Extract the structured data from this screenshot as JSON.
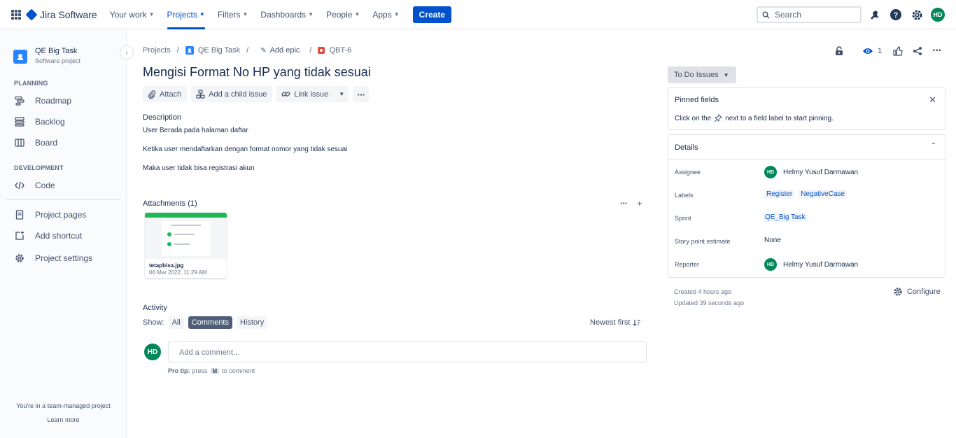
{
  "topnav": {
    "product": "Jira Software",
    "items": [
      {
        "label": "Your work",
        "active": false
      },
      {
        "label": "Projects",
        "active": true
      },
      {
        "label": "Filters",
        "active": false
      },
      {
        "label": "Dashboards",
        "active": false
      },
      {
        "label": "People",
        "active": false
      },
      {
        "label": "Apps",
        "active": false
      }
    ],
    "create_label": "Create",
    "search_placeholder": "Search",
    "avatar_initials": "HD",
    "accent_color": "#0052cc"
  },
  "sidebar": {
    "project_name": "QE Big Task",
    "project_type": "Software project",
    "section_planning": "PLANNING",
    "section_development": "DEVELOPMENT",
    "items": {
      "roadmap": "Roadmap",
      "backlog": "Backlog",
      "board": "Board",
      "code": "Code",
      "project_pages": "Project pages",
      "add_shortcut": "Add shortcut",
      "project_settings": "Project settings"
    },
    "footer_text": "You're in a team-managed project",
    "footer_link": "Learn more"
  },
  "breadcrumb": {
    "projects": "Projects",
    "project": "QE Big Task",
    "add_epic": "Add epic",
    "issue_key": "QBT-6"
  },
  "issue": {
    "title": "Mengisi Format No HP yang tidak sesuai",
    "actions": {
      "attach": "Attach",
      "add_child": "Add a child issue",
      "link_issue": "Link issue"
    },
    "description_label": "Description",
    "description_lines": [
      "User Berada pada halaman daftar",
      "Ketika user mendaftarkan dengan format nomor yang tidak sesuai",
      "Maka user tidak bisa registrasi akun"
    ],
    "attachments_label": "Attachments (1)",
    "attachment": {
      "file_name": "tetapbisa.jpg",
      "date": "06 Mar 2022, 11:29 AM"
    },
    "activity_label": "Activity",
    "show_label": "Show:",
    "filters": {
      "all": "All",
      "comments": "Comments",
      "history": "History"
    },
    "sort_label": "Newest first",
    "comment_avatar": "HD",
    "comment_placeholder": "Add a comment...",
    "protip_label": "Pro tip:",
    "protip_press": "press",
    "protip_key": "M",
    "protip_rest": "to comment"
  },
  "right": {
    "watchers_count": "1",
    "status_label": "To Do Issues",
    "pinned_title": "Pinned fields",
    "pinned_hint_before": "Click on the",
    "pinned_hint_after": "next to a field label to start pinning.",
    "details_title": "Details",
    "fields": {
      "assignee_label": "Assignee",
      "assignee": "Helmy Yusuf Darmawan",
      "labels_label": "Labels",
      "labels": [
        "Register",
        "NegativeCase"
      ],
      "sprint_label": "Sprint",
      "sprint": "QE_Big Task",
      "story_points_label": "Story point estimate",
      "story_points": "None",
      "reporter_label": "Reporter",
      "reporter": "Helmy Yusuf Darmawan",
      "avatar_initials": "HD"
    },
    "created": "Created 4 hours ago",
    "updated": "Updated 39 seconds ago",
    "configure_label": "Configure"
  }
}
